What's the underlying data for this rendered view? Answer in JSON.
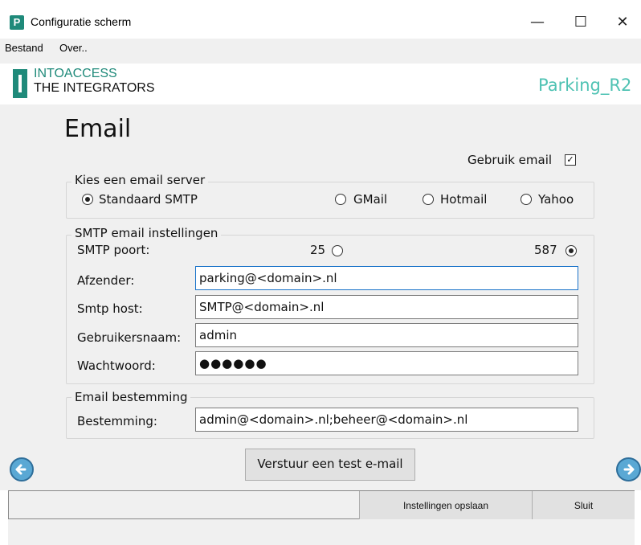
{
  "window": {
    "title": "Configuratie scherm",
    "app_icon_letter": "P",
    "minimize_glyph": "—",
    "maximize_glyph": "☐",
    "close_glyph": "✕"
  },
  "menu": {
    "items": [
      "Bestand",
      "Over.."
    ]
  },
  "brand": {
    "line1": "INTOACCESS",
    "line2": "THE INTEGRATORS",
    "site": "Parking_R2"
  },
  "page": {
    "title": "Email"
  },
  "use_email": {
    "label": "Gebruik email",
    "checked": true,
    "check_glyph": "✓"
  },
  "server_group": {
    "legend": "Kies een email server",
    "options": [
      {
        "label": "Standaard SMTP",
        "selected": true
      },
      {
        "label": "GMail",
        "selected": false
      },
      {
        "label": "Hotmail",
        "selected": false
      },
      {
        "label": "Yahoo",
        "selected": false
      }
    ]
  },
  "smtp_group": {
    "legend": "SMTP email instellingen",
    "port_label": "SMTP poort:",
    "port_options": [
      {
        "label": "25",
        "selected": false
      },
      {
        "label": "587",
        "selected": true
      }
    ],
    "fields": [
      {
        "label": "Afzender:",
        "value": "parking@<domain>.nl"
      },
      {
        "label": "Smtp host:",
        "value": "SMTP@<domain>.nl"
      },
      {
        "label": "Gebruikersnaam:",
        "value": "admin"
      },
      {
        "label": "Wachtwoord:",
        "value": "●●●●●●"
      }
    ]
  },
  "destination_group": {
    "legend": "Email bestemming",
    "field_label": "Bestemming:",
    "value": "admin@<domain>.nl;beheer@<domain>.nl"
  },
  "buttons": {
    "test_email": "Verstuur een test e-mail",
    "save": "Instellingen opslaan",
    "close": "Sluit"
  },
  "colors": {
    "brand_teal": "#1f8a7a",
    "site_teal": "#4ec2b3",
    "nav_blue": "#5aa8d4",
    "focus_border": "#1a73c9"
  }
}
